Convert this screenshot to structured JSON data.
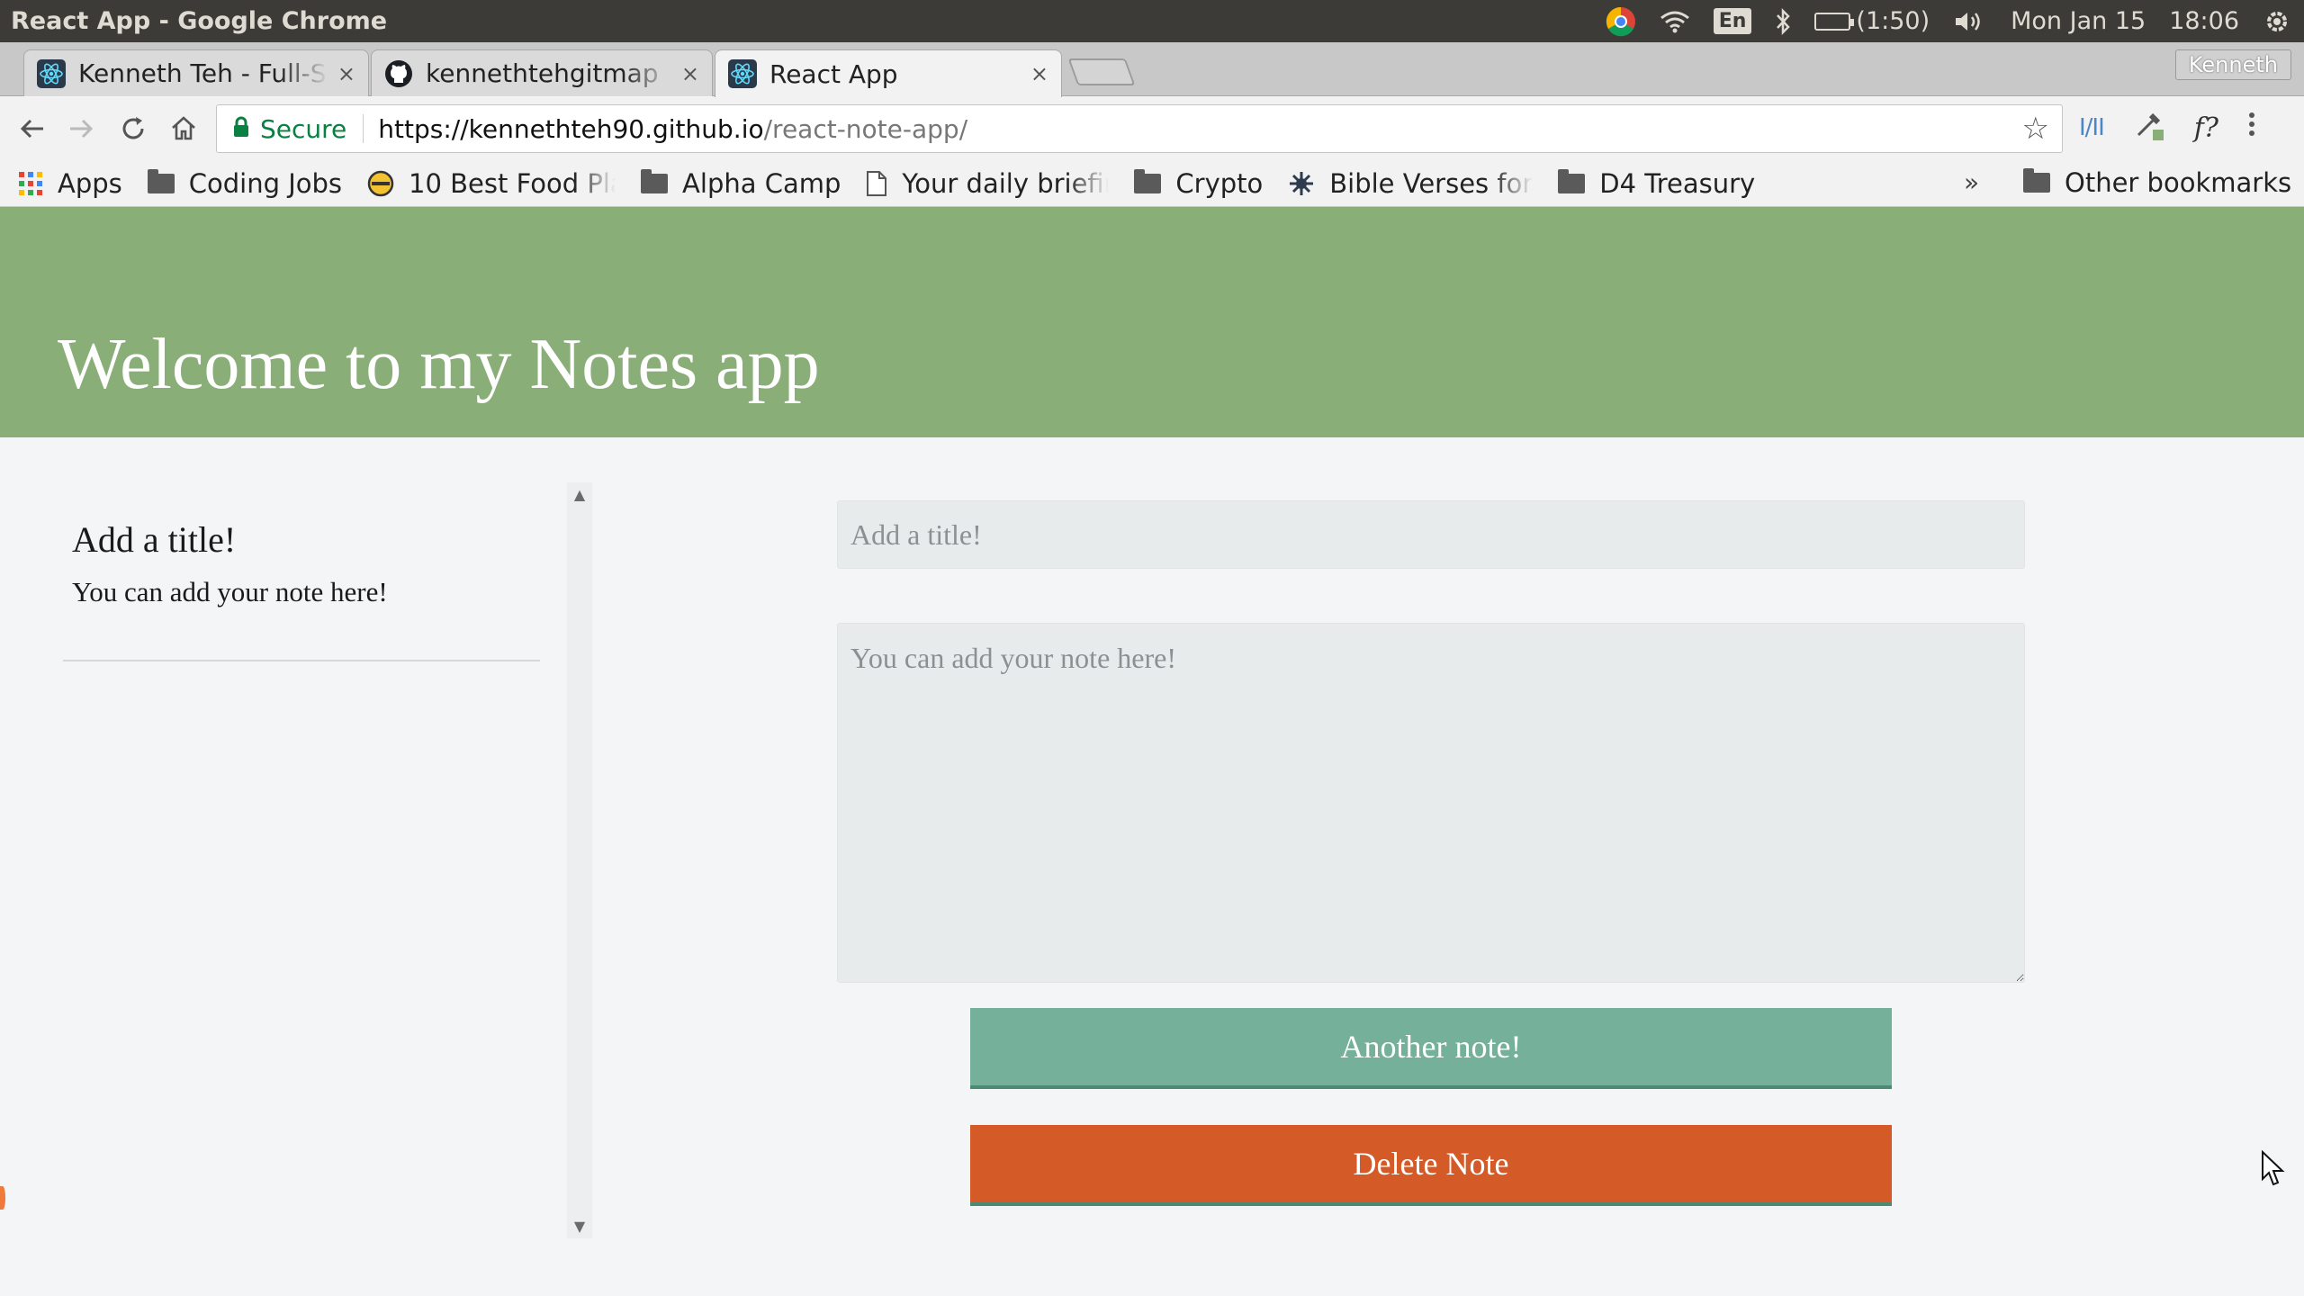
{
  "os": {
    "window_title": "React App - Google Chrome",
    "keyboard": "En",
    "battery_text": "(1:50)",
    "battery_level": 0.5,
    "date": "Mon Jan 15",
    "time": "18:06",
    "icons": [
      "chrome-icon",
      "wifi-icon",
      "bluetooth-icon",
      "battery-icon",
      "volume-icon",
      "gear-icon"
    ]
  },
  "browser": {
    "tabs": [
      {
        "label": "Kenneth Teh - Full-S",
        "favicon": "react-icon",
        "close": "×"
      },
      {
        "label": "kennethtehgitmap",
        "favicon": "github-icon",
        "close": "×"
      },
      {
        "label": "React App",
        "favicon": "react-icon",
        "close": "×",
        "active": true
      }
    ],
    "profile": "Kenneth",
    "address": {
      "secure_label": "Secure",
      "url_host": "https://kennethteh90.github.io",
      "url_path": "/react-note-app/"
    },
    "bookmarks": [
      {
        "label": "Apps",
        "icon": "apps-grid-icon"
      },
      {
        "label": "Coding Jobs",
        "icon": "folder-icon"
      },
      {
        "label": "10 Best Food Pla",
        "icon": "food-site-icon"
      },
      {
        "label": "Alpha Camp",
        "icon": "folder-icon"
      },
      {
        "label": "Your daily briefir",
        "icon": "page-icon"
      },
      {
        "label": "Crypto",
        "icon": "folder-icon"
      },
      {
        "label": "Bible Verses for",
        "icon": "bible-site-icon"
      },
      {
        "label": "D4 Treasury",
        "icon": "folder-icon"
      }
    ],
    "bookmarks_overflow": "»",
    "other_bookmarks": "Other bookmarks",
    "extensions": {
      "history": "I/II",
      "formula": "f?"
    }
  },
  "app": {
    "header": "Welcome to my Notes app",
    "notes": [
      {
        "title": "Add a title!",
        "body": "You can add your note here!"
      }
    ],
    "editor": {
      "title_placeholder": "Add a title!",
      "body_placeholder": "You can add your note here!",
      "another_button": "Another note!",
      "delete_button": "Delete Note"
    },
    "colors": {
      "header_bg": "#8aae77",
      "another_bg": "#74b09a",
      "delete_bg": "#d45a28"
    }
  }
}
